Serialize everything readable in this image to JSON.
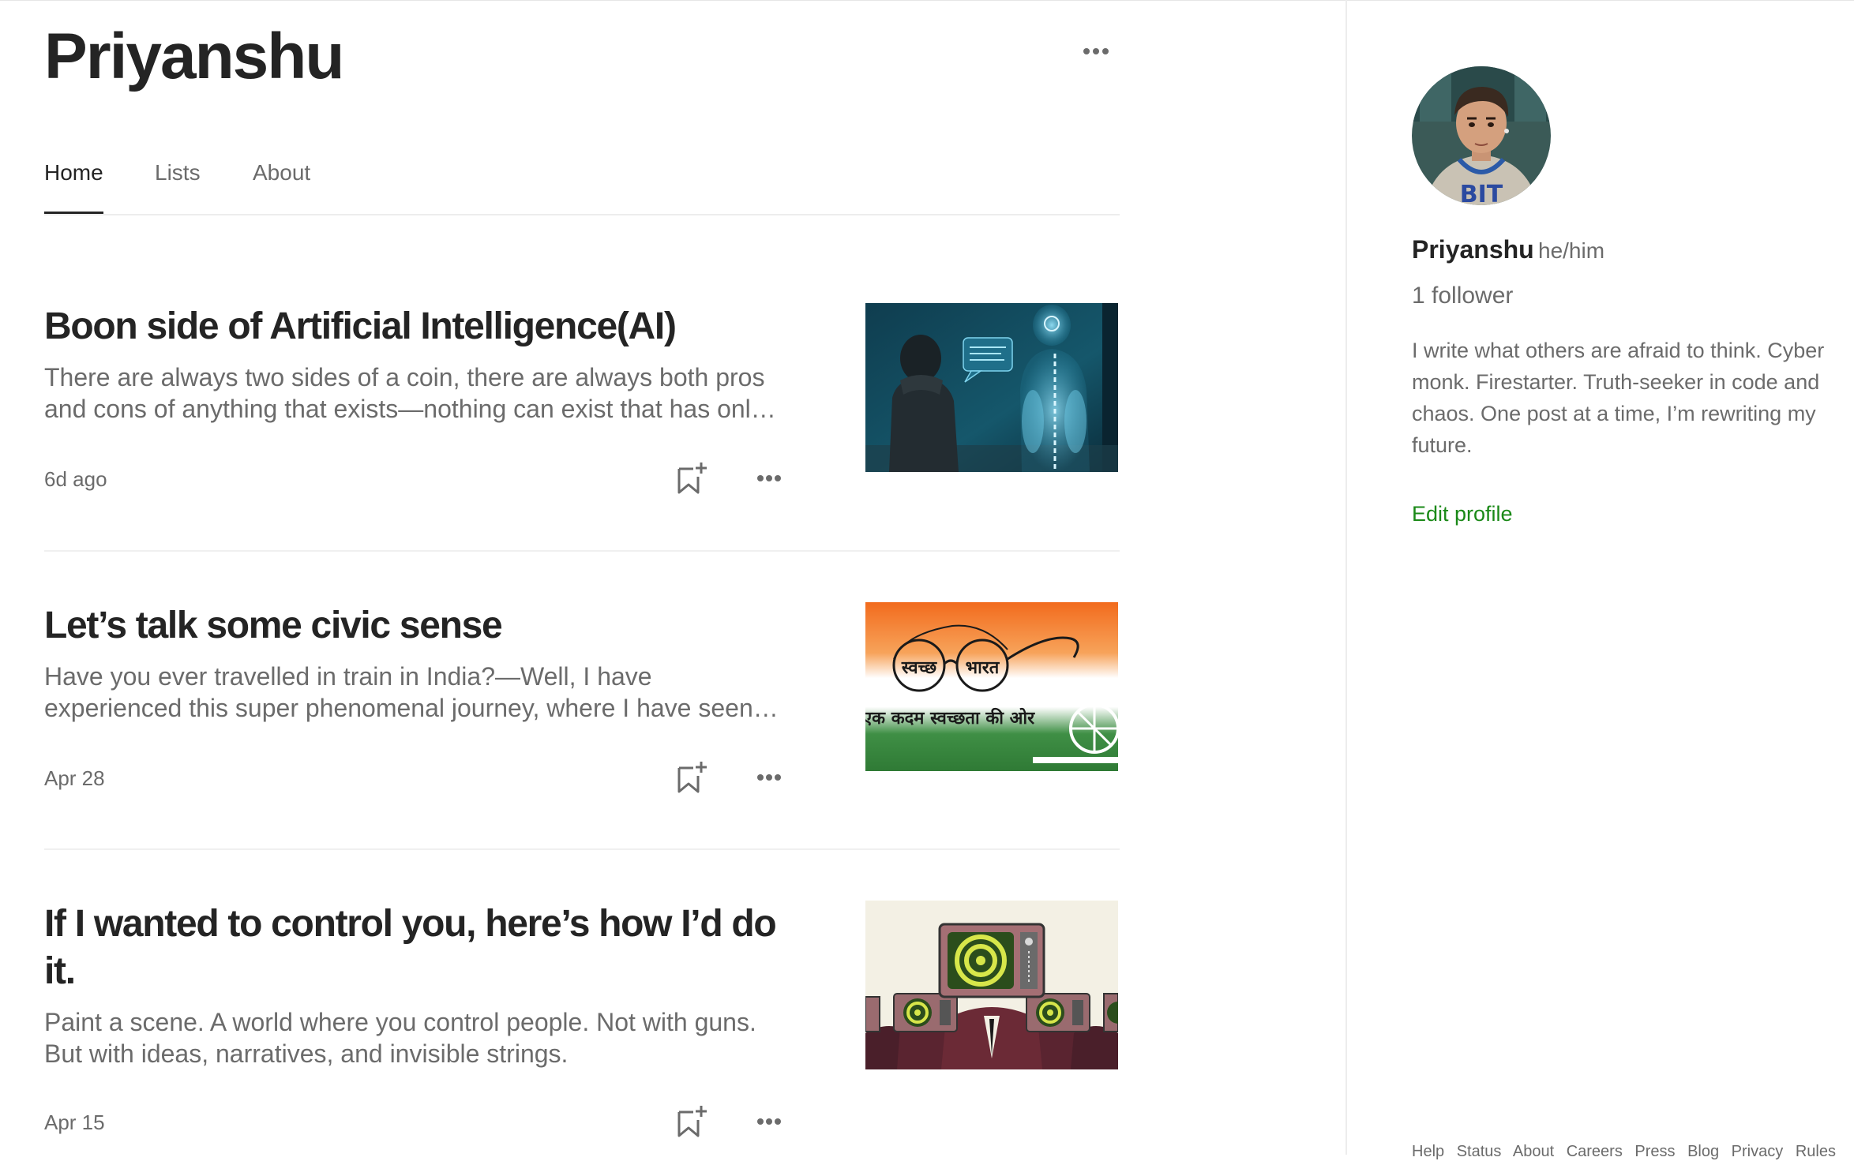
{
  "profile": {
    "name": "Priyanshu"
  },
  "tabs": [
    {
      "label": "Home",
      "active": true
    },
    {
      "label": "Lists",
      "active": false
    },
    {
      "label": "About",
      "active": false
    }
  ],
  "articles": [
    {
      "title": "Boon side of Artificial Intelligence(AI)",
      "excerpt": "There are always two sides of a coin, there are always both pros and cons of anything that exists—nothing can exist that has onl…",
      "date": "6d ago",
      "image_alt": "hooded person facing a transparent robot"
    },
    {
      "title": "Let’s talk some civic sense",
      "excerpt": "Have you ever travelled in train in India?—Well, I have experienced this super phenomenal journey, where I have seen…",
      "date": "Apr 28",
      "image_text_1": "स्वच्छ",
      "image_text_2": "भारत",
      "image_text_3": "एक कदम स्वच्छता की ओर"
    },
    {
      "title": "If I wanted to control you, here’s how I’d do it.",
      "excerpt": "Paint a scene. A world where you control people. Not with guns. But with ideas, narratives, and invisible strings.",
      "date": "Apr 15",
      "image_alt": "people with hypnotic television heads"
    }
  ],
  "sidebar": {
    "name": "Priyanshu",
    "pronouns": "he/him",
    "followers": "1 follower",
    "bio": "I write what others are afraid to think. Cyber monk. Firestarter. Truth-seeker in code and chaos. One post at a time, I’m rewriting my future.",
    "edit_profile": "Edit profile",
    "footer_links": [
      "Help",
      "Status",
      "About",
      "Careers",
      "Press",
      "Blog",
      "Privacy",
      "Rules"
    ]
  },
  "colors": {
    "text": "#242424",
    "muted": "#6b6b6b",
    "accent_green": "#1a8917",
    "divider": "#f0f0f0"
  },
  "icons": [
    "more-horizontal-icon",
    "bookmark-add-icon"
  ]
}
